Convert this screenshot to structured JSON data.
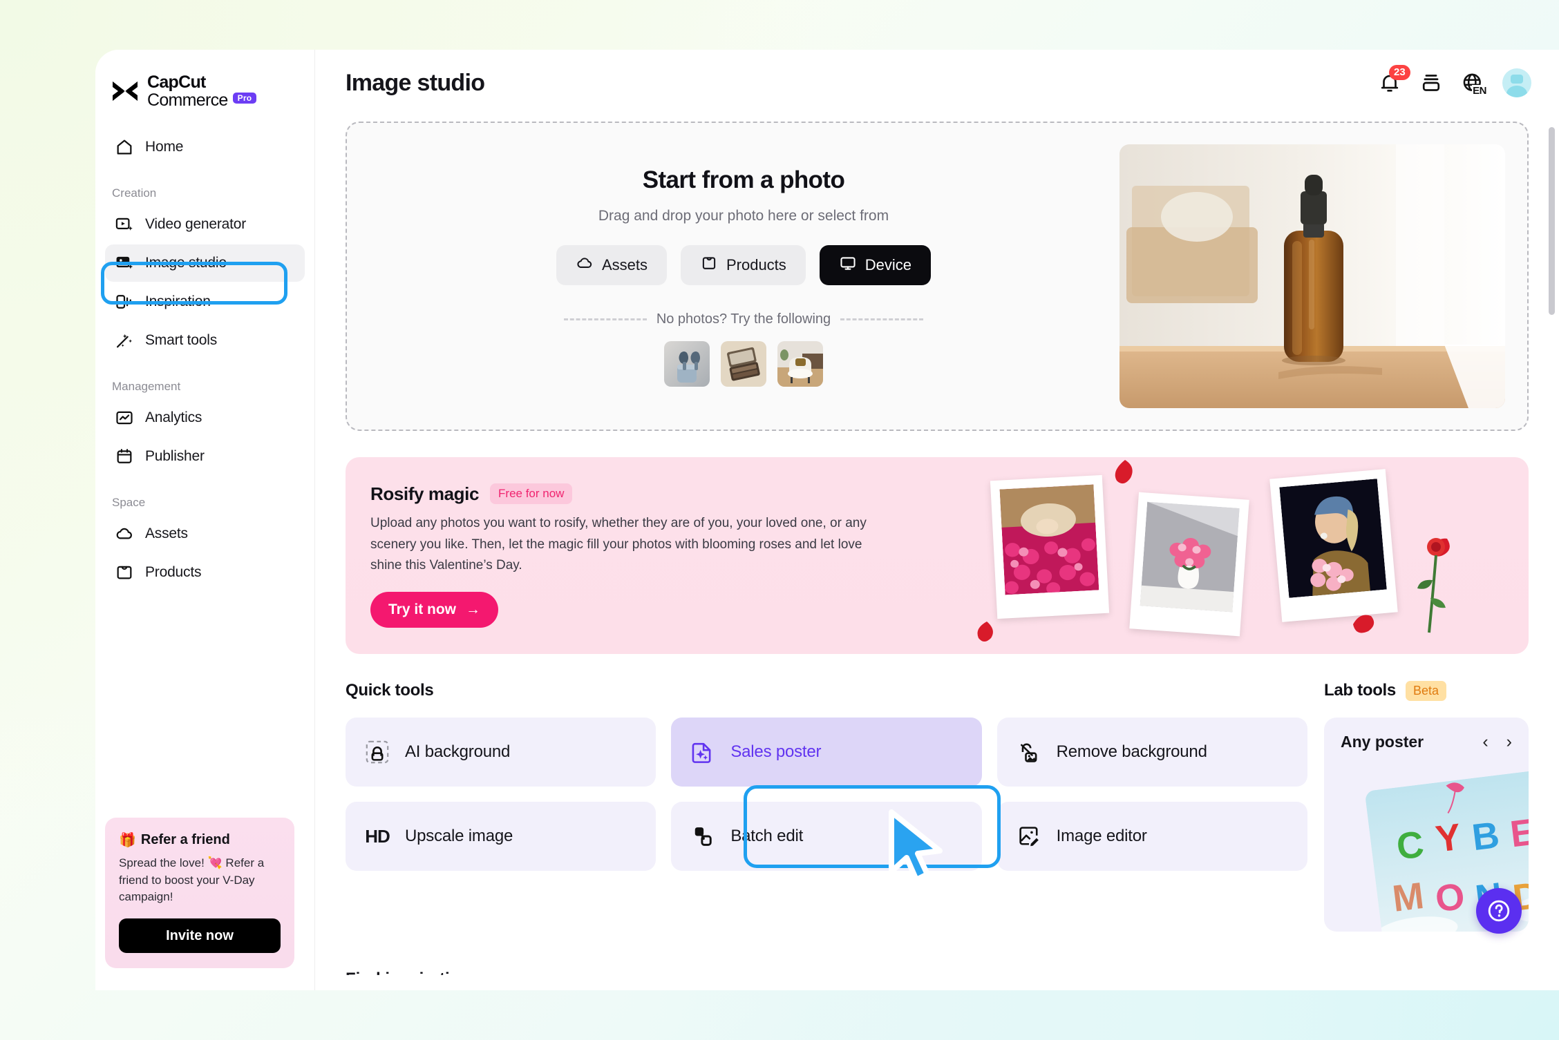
{
  "brand": {
    "name_line1": "CapCut",
    "name_line2": "Commerce",
    "pro_badge": "Pro"
  },
  "sidebar": {
    "home": {
      "label": "Home",
      "icon": "home-icon"
    },
    "sections": [
      {
        "label": "Creation",
        "items": [
          {
            "label": "Video generator",
            "icon": "video-generator-icon",
            "active": false
          },
          {
            "label": "Image studio",
            "icon": "image-studio-icon",
            "active": true
          },
          {
            "label": "Inspiration",
            "icon": "inspiration-icon",
            "active": false
          },
          {
            "label": "Smart tools",
            "icon": "magic-wand-icon",
            "active": false
          }
        ]
      },
      {
        "label": "Management",
        "items": [
          {
            "label": "Analytics",
            "icon": "analytics-icon",
            "active": false
          },
          {
            "label": "Publisher",
            "icon": "calendar-icon",
            "active": false
          }
        ]
      },
      {
        "label": "Space",
        "items": [
          {
            "label": "Assets",
            "icon": "cloud-icon",
            "active": false
          },
          {
            "label": "Products",
            "icon": "bag-icon",
            "active": false
          }
        ]
      }
    ],
    "refer_card": {
      "title": "Refer a friend",
      "title_emoji": "🎁",
      "body": "Spread the love! 💘 Refer a friend to boost your V-Day campaign!",
      "button": "Invite now"
    }
  },
  "header": {
    "title": "Image studio",
    "notification_count": "23",
    "language": "EN"
  },
  "upload": {
    "title": "Start from a photo",
    "subtitle": "Drag and drop your photo here or select from",
    "buttons": [
      {
        "label": "Assets",
        "icon": "cloud-icon",
        "primary": false
      },
      {
        "label": "Products",
        "icon": "bag-icon",
        "primary": false
      },
      {
        "label": "Device",
        "icon": "monitor-icon",
        "primary": true
      }
    ],
    "divider_text": "No photos? Try the following",
    "samples": [
      {
        "name": "earbuds-thumbnail"
      },
      {
        "name": "makeup-palette-thumbnail"
      },
      {
        "name": "armchair-thumbnail"
      }
    ],
    "hero_photo": "amber-serum-bottle-on-wood-table"
  },
  "rosify": {
    "title": "Rosify magic",
    "tag": "Free for now",
    "body": "Upload any photos you want to rosify, whether they are of you, your loved one, or any scenery you like. Then, let the magic fill your photos with blooming roses and let love shine this Valentine’s Day.",
    "button": "Try it now",
    "button_arrow": "→"
  },
  "quick_tools": {
    "title": "Quick tools",
    "cards": [
      {
        "label": "AI background",
        "icon": "ai-background-icon",
        "highlight": false
      },
      {
        "label": "Sales poster",
        "icon": "sales-poster-icon",
        "highlight": true
      },
      {
        "label": "Remove background",
        "icon": "remove-background-icon",
        "highlight": false
      },
      {
        "label": "Upscale image",
        "icon": "hd-icon",
        "highlight": false
      },
      {
        "label": "Batch edit",
        "icon": "batch-edit-icon",
        "highlight": false
      },
      {
        "label": "Image editor",
        "icon": "image-editor-icon",
        "highlight": false
      }
    ]
  },
  "lab_tools": {
    "title": "Lab tools",
    "tag": "Beta",
    "card_title": "Any poster",
    "prev_arrow": "‹",
    "next_arrow": "›",
    "poster_text": "CYBER MONDAY"
  },
  "cut_off_heading": "Find inspiration",
  "colors": {
    "annotation_blue": "#1fa0f0",
    "accent_purple": "#6134f0",
    "brand_pro": "#6c3df4",
    "rosify_pink": "#f4186f",
    "badge_red": "#fc4242",
    "beta_amber": "#e07b10"
  }
}
